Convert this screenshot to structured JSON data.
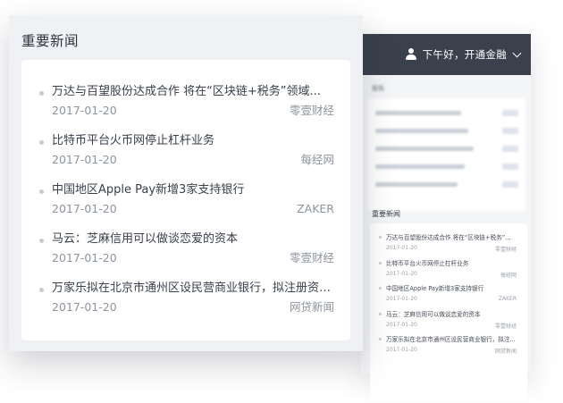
{
  "header": {
    "greeting": "下午好，开通金融"
  },
  "blurred_section": {
    "title": "报告",
    "rows": 5
  },
  "news": {
    "title": "重要新闻",
    "items": [
      {
        "title": "万达与百望股份达成合作 将在“区块链+税务”领域...",
        "mini_title": "万达与百望股份达成合作 将在“区块链+税务”...",
        "date": "2017-01-20",
        "source": "零壹财经"
      },
      {
        "title": "比特币平台火币网停止杠杆业务",
        "mini_title": "比特币平台火币网停止杠杆业务",
        "date": "2017-01-20",
        "source": "每经网"
      },
      {
        "title": "中国地区Apple Pay新增3家支持银行",
        "mini_title": "中国地区Apple Pay新增3家支持银行",
        "date": "2017-01-20",
        "source": "ZAKER"
      },
      {
        "title": "马云：芝麻信用可以做谈恋爱的资本",
        "mini_title": "马云：芝麻信用可以做谈恋爱的资本",
        "date": "2017-01-20",
        "source": "零壹财经"
      },
      {
        "title": "万家乐拟在北京市通州区设民营商业银行，拟注册资本...",
        "mini_title": "万家乐拟在北京市通州区设民营商业银行，拟注...",
        "date": "2017-01-20",
        "source": "网贷新闻"
      }
    ]
  }
}
